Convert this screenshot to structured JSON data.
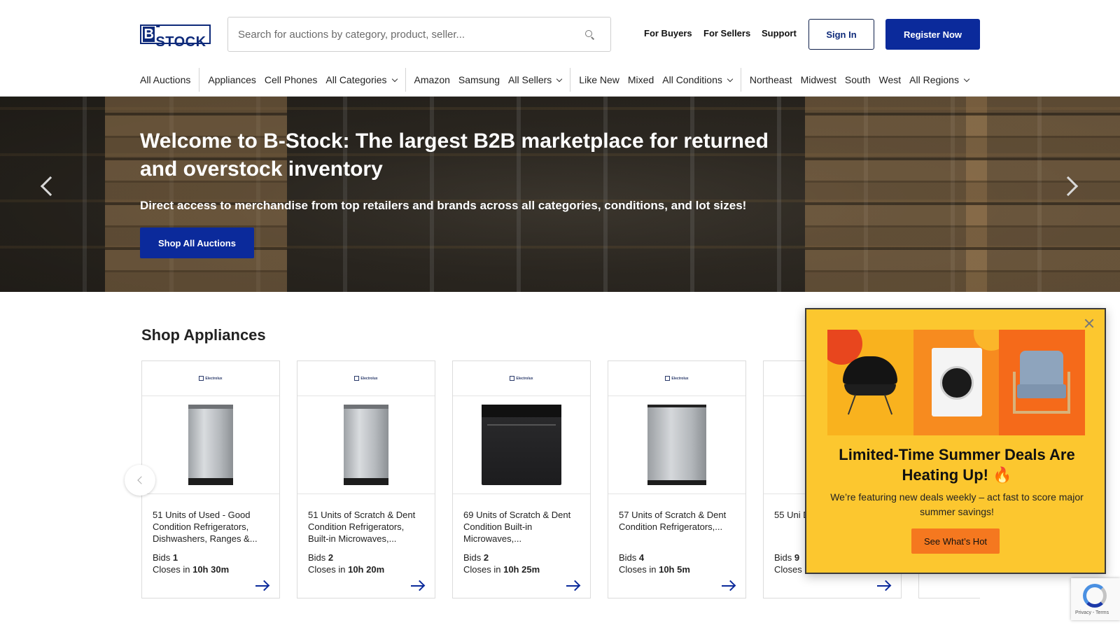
{
  "header": {
    "logo_text": "B-STOCK",
    "search_placeholder": "Search for auctions by category, product, seller...",
    "nav": [
      "For Buyers",
      "For Sellers",
      "Support"
    ],
    "sign_in": "Sign In",
    "register": "Register Now"
  },
  "categories": {
    "all_auctions": "All Auctions",
    "group1": [
      "Appliances",
      "Cell Phones"
    ],
    "all_categories": "All Categories",
    "group2": [
      "Amazon",
      "Samsung"
    ],
    "all_sellers": "All Sellers",
    "group3": [
      "Like New",
      "Mixed"
    ],
    "all_conditions": "All Conditions",
    "group4": [
      "Northeast",
      "Midwest",
      "South",
      "West"
    ],
    "all_regions": "All Regions"
  },
  "hero": {
    "title": "Welcome to B-Stock: The largest B2B marketplace for returned and overstock inventory",
    "subtitle": "Direct access to merchandise from top retailers and brands across all categories, conditions, and lot sizes!",
    "cta": "Shop All Auctions"
  },
  "section": {
    "title": "Shop Appliances",
    "cards": [
      {
        "desc": "51 Units of Used - Good Condition Refrigerators, Dishwashers, Ranges &...",
        "bids_label": "Bids",
        "bids": "1",
        "closes_label": "Closes in",
        "closes": "10h 30m",
        "image": "dishwasher"
      },
      {
        "desc": "51 Units of Scratch & Dent Condition Refrigerators, Built-in Microwaves,...",
        "bids_label": "Bids",
        "bids": "2",
        "closes_label": "Closes in",
        "closes": "10h 20m",
        "image": "dishwasher"
      },
      {
        "desc": "69 Units of Scratch & Dent Condition Built-in Microwaves,...",
        "bids_label": "Bids",
        "bids": "2",
        "closes_label": "Closes in",
        "closes": "10h 25m",
        "image": "range"
      },
      {
        "desc": "57 Units of Scratch & Dent Condition Refrigerators,...",
        "bids_label": "Bids",
        "bids": "4",
        "closes_label": "Closes in",
        "closes": "10h 5m",
        "image": "dishwasher"
      },
      {
        "desc": "55 Uni Dent C Refrige",
        "bids_label": "Bids",
        "bids": "9",
        "closes_label": "Closes",
        "closes": "",
        "image": "none"
      }
    ],
    "brand_logo": "Electrolux"
  },
  "popup": {
    "title": "Limited-Time Summer Deals Are Heating Up! 🔥",
    "text": "We’re featuring new deals weekly – act fast to score major summer savings!",
    "button": "See What’s Hot"
  },
  "recaptcha": {
    "text": "Privacy - Terms"
  },
  "colors": {
    "brand_blue": "#0b2a9b",
    "popup_yellow": "#fcc72f",
    "popup_orange": "#f5781f"
  }
}
